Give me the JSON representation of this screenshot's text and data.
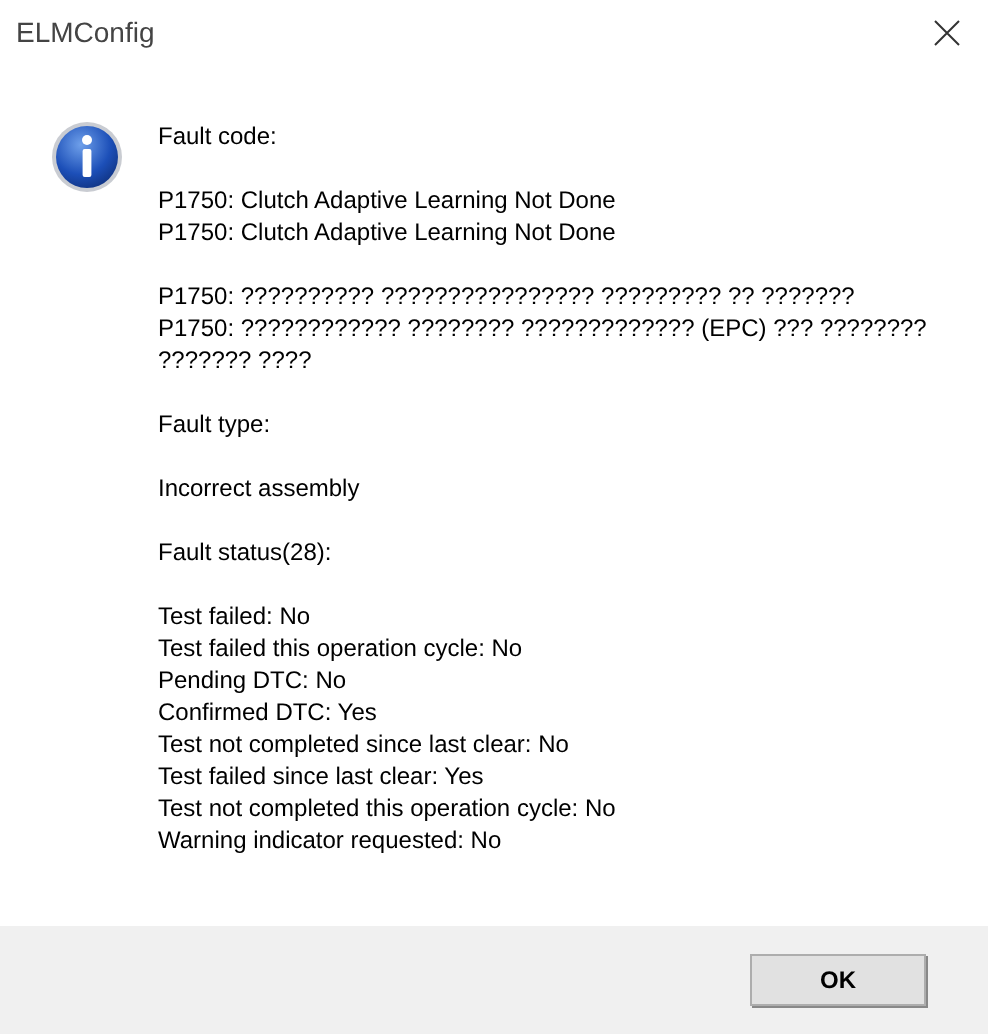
{
  "window": {
    "title": "ELMConfig"
  },
  "message": {
    "paragraphs": [
      [
        "Fault code:"
      ],
      [
        "P1750: Clutch Adaptive Learning Not Done",
        "P1750: Clutch Adaptive Learning Not Done"
      ],
      [
        "P1750: ?????????? ???????????????? ????????? ?? ???????",
        "P1750: ???????????? ???????? ????????????? (EPC) ??? ????????",
        "??????? ????"
      ],
      [
        "Fault type:"
      ],
      [
        "Incorrect assembly"
      ],
      [
        "Fault status(28):"
      ],
      [
        "Test failed: No",
        "Test failed this operation cycle: No",
        "Pending DTC: No",
        "Confirmed DTC: Yes",
        "Test not completed since last clear: No",
        "Test failed since last clear: Yes",
        "Test not completed this operation cycle: No",
        "Warning indicator requested: No"
      ]
    ]
  },
  "buttons": [
    "OK"
  ]
}
